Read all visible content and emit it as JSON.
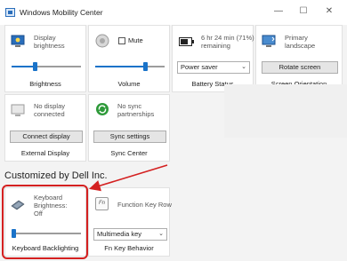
{
  "window": {
    "title": "Windows Mobility Center",
    "minimize_glyph": "—",
    "maximize_glyph": "☐",
    "close_glyph": "✕"
  },
  "tiles": {
    "brightness": {
      "label_line1": "Display",
      "label_line2": "brightness",
      "footer": "Brightness",
      "level": 0.33,
      "icon": "display-brightness-icon"
    },
    "volume": {
      "mute_label": "Mute",
      "muted": false,
      "footer": "Volume",
      "level": 0.72,
      "icon": "speaker-icon"
    },
    "battery": {
      "status_line1": "6 hr 24 min (71%)",
      "status_line2": "remaining",
      "plan_selected": "Power saver",
      "footer": "Battery Status",
      "icon": "battery-icon"
    },
    "screen_orientation": {
      "label_line1": "Primary",
      "label_line2": "landscape",
      "button": "Rotate screen",
      "footer": "Screen Orientation",
      "icon": "screen-rotate-icon"
    },
    "external_display": {
      "label_line1": "No display",
      "label_line2": "connected",
      "button": "Connect display",
      "footer": "External Display",
      "icon": "external-display-icon"
    },
    "sync_center": {
      "label_line1": "No sync",
      "label_line2": "partnerships",
      "button": "Sync settings",
      "footer": "Sync Center",
      "icon": "sync-icon"
    }
  },
  "custom_section": {
    "heading": "Customized by Dell Inc.",
    "keyboard_backlighting": {
      "label_line1": "Keyboard",
      "label_line2": "Brightness:",
      "label_line3": "Off",
      "footer": "Keyboard Backlighting",
      "level": 0.0,
      "icon": "keyboard-backlight-icon"
    },
    "fn_key_behavior": {
      "label": "Function Key Row",
      "selected": "Multimedia key",
      "footer": "Fn Key Behavior",
      "icon": "fn-key-icon",
      "icon_text": "Fn"
    }
  },
  "colors": {
    "accent": "#1a73c9",
    "highlight": "#d42020",
    "sync_green": "#2e9a3a"
  }
}
